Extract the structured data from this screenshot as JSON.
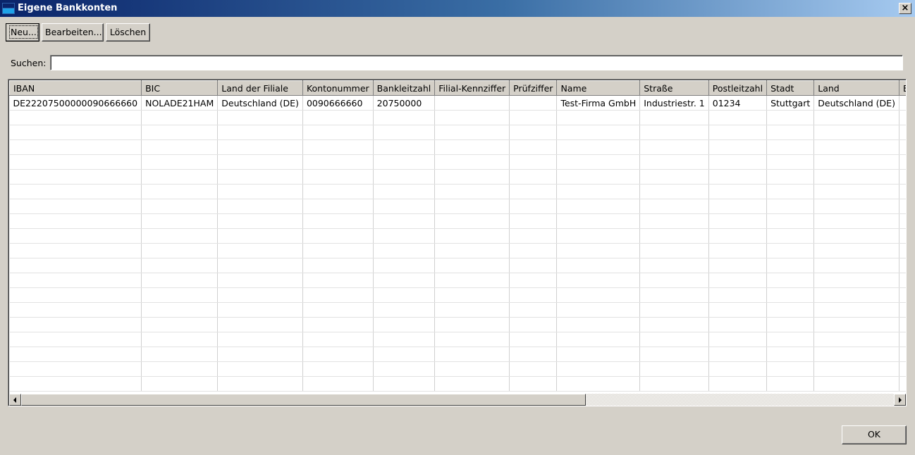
{
  "window": {
    "title": "Eigene Bankkonten",
    "close_label": "×"
  },
  "toolbar": {
    "new_label": "Neu...",
    "edit_label": "Bearbeiten...",
    "delete_label": "Löschen"
  },
  "search": {
    "label": "Suchen:",
    "value": "",
    "placeholder": ""
  },
  "table": {
    "columns": [
      "IBAN",
      "BIC",
      "Land der Filiale",
      "Kontonummer",
      "Bankleitzahl",
      "Filial-Kennziffer",
      "Prüfziffer",
      "Name",
      "Straße",
      "Postleitzahl",
      "Stadt",
      "Land",
      "E-Mail"
    ],
    "rows": [
      [
        "DE22207500000090666660",
        "NOLADE21HAM",
        "Deutschland (DE)",
        "0090666660",
        "20750000",
        "",
        "",
        "Test-Firma GmbH",
        "Industriestr. 1",
        "01234",
        "Stuttgart",
        "Deutschland (DE)",
        ""
      ]
    ]
  },
  "footer": {
    "ok_label": "OK"
  },
  "icons": {
    "window_icon": "bank-window-icon",
    "scroll_left": "arrow-left-icon",
    "scroll_right": "arrow-right-icon"
  },
  "colors": {
    "titlebar_start": "#0a246a",
    "titlebar_end": "#a6caf0",
    "dialog_bg": "#d4d0c8"
  }
}
